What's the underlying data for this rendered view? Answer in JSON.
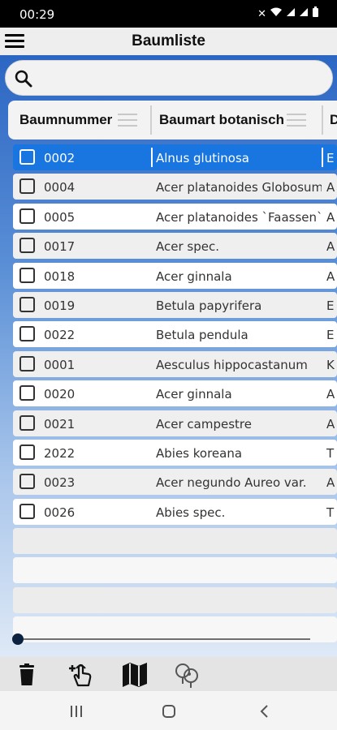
{
  "status_bar": {
    "time": "00:29",
    "icons": [
      "mute-icon",
      "wifi-icon",
      "signal-icon",
      "signal-icon",
      "battery-icon"
    ]
  },
  "app_bar": {
    "title": "Baumliste"
  },
  "search": {
    "placeholder": ""
  },
  "grid": {
    "columns": [
      {
        "label": "Baumnummer"
      },
      {
        "label": "Baumart botanisch"
      },
      {
        "label": "D"
      }
    ],
    "rows": [
      {
        "nr": "0002",
        "botanisch": "Alnus glutinosa",
        "c3": "E",
        "selected": true
      },
      {
        "nr": "0004",
        "botanisch": "Acer platanoides Globosum",
        "c3": "A"
      },
      {
        "nr": "0005",
        "botanisch": "Acer platanoides `Faassen`:",
        "c3": "A"
      },
      {
        "nr": "0017",
        "botanisch": "Acer spec.",
        "c3": "A"
      },
      {
        "nr": "0018",
        "botanisch": "Acer ginnala",
        "c3": "A"
      },
      {
        "nr": "0019",
        "botanisch": "Betula papyrifera",
        "c3": "E"
      },
      {
        "nr": "0022",
        "botanisch": "Betula pendula",
        "c3": "E"
      },
      {
        "nr": "0001",
        "botanisch": "Aesculus hippocastanum",
        "c3": "K"
      },
      {
        "nr": "0020",
        "botanisch": "Acer ginnala",
        "c3": "A"
      },
      {
        "nr": "0021",
        "botanisch": "Acer campestre",
        "c3": "A"
      },
      {
        "nr": "2022",
        "botanisch": "Abies koreana",
        "c3": "T"
      },
      {
        "nr": "0023",
        "botanisch": "Acer negundo Aureo var.",
        "c3": "A"
      },
      {
        "nr": "0026",
        "botanisch": "Abies spec.",
        "c3": "T"
      }
    ],
    "empty_rows": 4
  },
  "toolbar": {
    "items": [
      "delete-icon",
      "add-touch-icon",
      "map-icon",
      "locations-icon"
    ]
  },
  "nav_bar": {
    "items": [
      "recents-button",
      "home-button",
      "back-button"
    ]
  },
  "colors": {
    "selected_row": "#1976e0",
    "gradient_top": "#2b66c3",
    "gradient_bottom": "#dfe9f6"
  }
}
